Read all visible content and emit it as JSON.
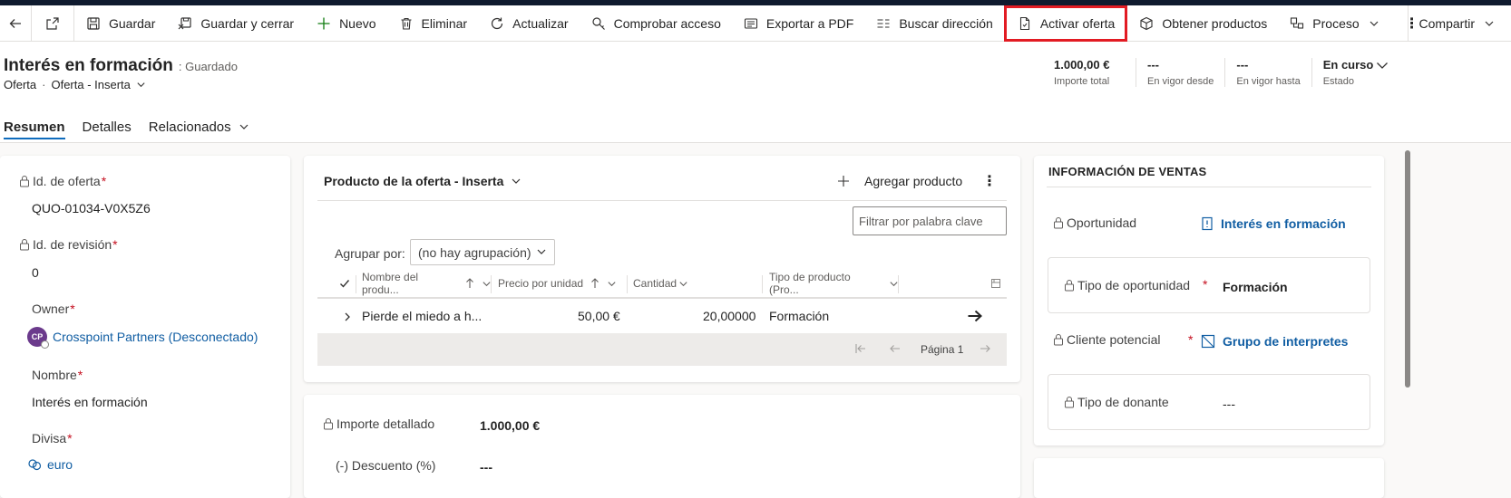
{
  "commands": {
    "save": "Guardar",
    "save_close": "Guardar y cerrar",
    "new": "Nuevo",
    "delete": "Eliminar",
    "refresh": "Actualizar",
    "check_access": "Comprobar acceso",
    "export_pdf": "Exportar a PDF",
    "find_address": "Buscar dirección",
    "activate_quote": "Activar oferta",
    "get_products": "Obtener productos",
    "process": "Proceso",
    "more": "⋮",
    "share": "Compartir"
  },
  "header": {
    "title": "Interés en formación",
    "saved_status": ": Guardado",
    "entity": "Oferta",
    "form_name": "Oferta - Inserta",
    "fields": [
      {
        "value": "1.000,00 €",
        "label": "Importe total"
      },
      {
        "value": "---",
        "label": "En vigor desde"
      },
      {
        "value": "---",
        "label": "En vigor hasta"
      },
      {
        "value": "En curso",
        "label": "Estado"
      }
    ]
  },
  "tabs": {
    "summary": "Resumen",
    "details": "Detalles",
    "related": "Relacionados"
  },
  "left": {
    "quote_id_label": "Id. de oferta",
    "quote_id_value": "QUO-01034-V0X5Z6",
    "revision_label": "Id. de revisión",
    "revision_value": "0",
    "owner_label": "Owner",
    "owner_initials": "CP",
    "owner_value": "Crosspoint Partners (Desconectado)",
    "name_label": "Nombre",
    "name_value": "Interés en formación",
    "currency_label": "Divisa",
    "currency_value": "euro",
    "required": "*"
  },
  "grid": {
    "title": "Producto de la oferta - Inserta",
    "add_product": "Agregar producto",
    "more": "⋮",
    "filter_placeholder": "Filtrar por palabra clave",
    "group_by_label": "Agrupar por:",
    "group_by_value": "(no hay agrupación)",
    "columns": {
      "name": "Nombre del produ...",
      "price": "Precio por unidad",
      "quantity": "Cantidad",
      "type": "Tipo de producto (Pro..."
    },
    "rows": [
      {
        "name": "Pierde el miedo a h...",
        "price": "50,00 €",
        "quantity": "20,00000",
        "type": "Formación"
      }
    ],
    "page": "Página 1"
  },
  "amounts": {
    "detailed_label": "Importe detallado",
    "detailed_value": "1.000,00 €",
    "discount_label": "(-) Descuento (%)",
    "discount_value": "---"
  },
  "sales": {
    "title": "INFORMACIÓN DE VENTAS",
    "opportunity_label": "Oportunidad",
    "opportunity_value": "Interés en formación",
    "opp_type_label": "Tipo de oportunidad",
    "opp_type_value": "Formación",
    "prospect_label": "Cliente potencial",
    "prospect_value": "Grupo de interpretes",
    "donor_type_label": "Tipo de donante",
    "donor_type_value": "---",
    "required": "*"
  },
  "colors": {
    "accent": "#0f6cbd",
    "link": "#115ea3",
    "required": "#c50f1f",
    "highlight": "#e21b23",
    "avatar": "#6b3a8c"
  }
}
